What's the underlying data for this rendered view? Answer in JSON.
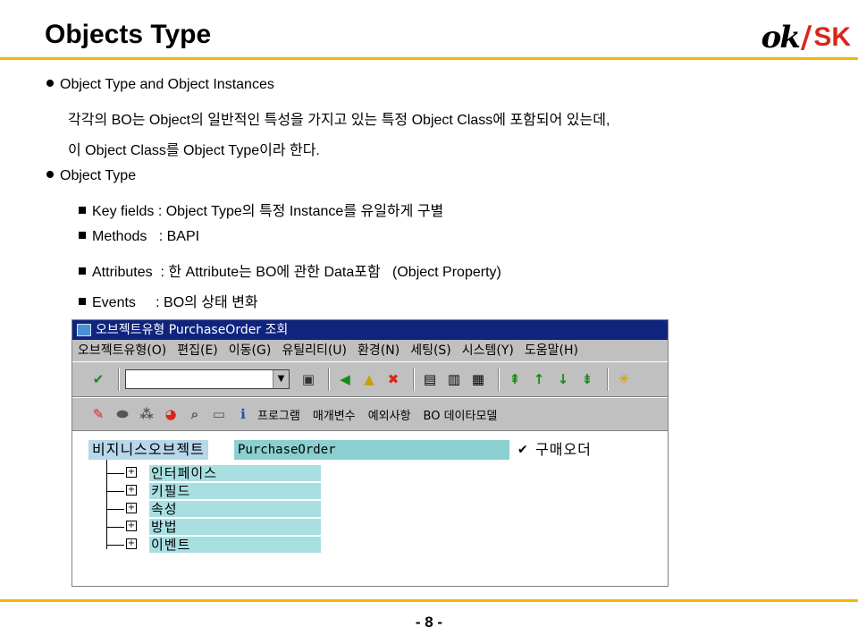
{
  "slide": {
    "title": "Objects Type",
    "page_number": "- 8 -",
    "logo": {
      "ok": "ok",
      "slash": "/",
      "sk": "SK"
    }
  },
  "content": {
    "lines": [
      {
        "kind": "dot",
        "text": "Object Type and Object Instances"
      },
      {
        "kind": "plain",
        "text": "각각의 BO는 Object의 일반적인 특성을 가지고 있는 특정 Object Class에 포함되어 있는데,"
      },
      {
        "kind": "plain",
        "text": "이 Object Class를 Object Type이라 한다."
      },
      {
        "kind": "dot",
        "text": "Object Type"
      },
      {
        "kind": "square",
        "text": "Key fields : Object Type의 특정 Instance를 유일하게 구별"
      },
      {
        "kind": "square",
        "text": "Methods   : BAPI"
      },
      {
        "kind": "square",
        "text": "Attributes  : 한 Attribute는 BO에 관한 Data포함   (Object Property)"
      },
      {
        "kind": "square",
        "text": "Events     : BO의 상태 변화"
      }
    ]
  },
  "sap": {
    "window_title": "오브젝트유형 PurchaseOrder 조회",
    "menu": [
      "오브젝트유형(O)",
      "편집(E)",
      "이동(G)",
      "유틸리티(U)",
      "환경(N)",
      "세팅(S)",
      "시스템(Y)",
      "도움말(H)"
    ],
    "app_toolbar_texts": [
      "프로그램",
      "매개변수",
      "예외사항",
      "BO 데이타모델"
    ],
    "bo_label": "비지니스오브젝트",
    "bo_value": "PurchaseOrder",
    "bo_check": "✔",
    "bo_description": "구매오더",
    "tree_nodes": [
      "인터페이스",
      "키필드",
      "속성",
      "방법",
      "이벤트"
    ],
    "colors": {
      "titlebar": "#10247e",
      "chrome": "#c0c0c0",
      "label_bg": "#b7d7ea",
      "value_bg": "#8ccfd1",
      "node_bg": "#a8e0e2"
    }
  }
}
